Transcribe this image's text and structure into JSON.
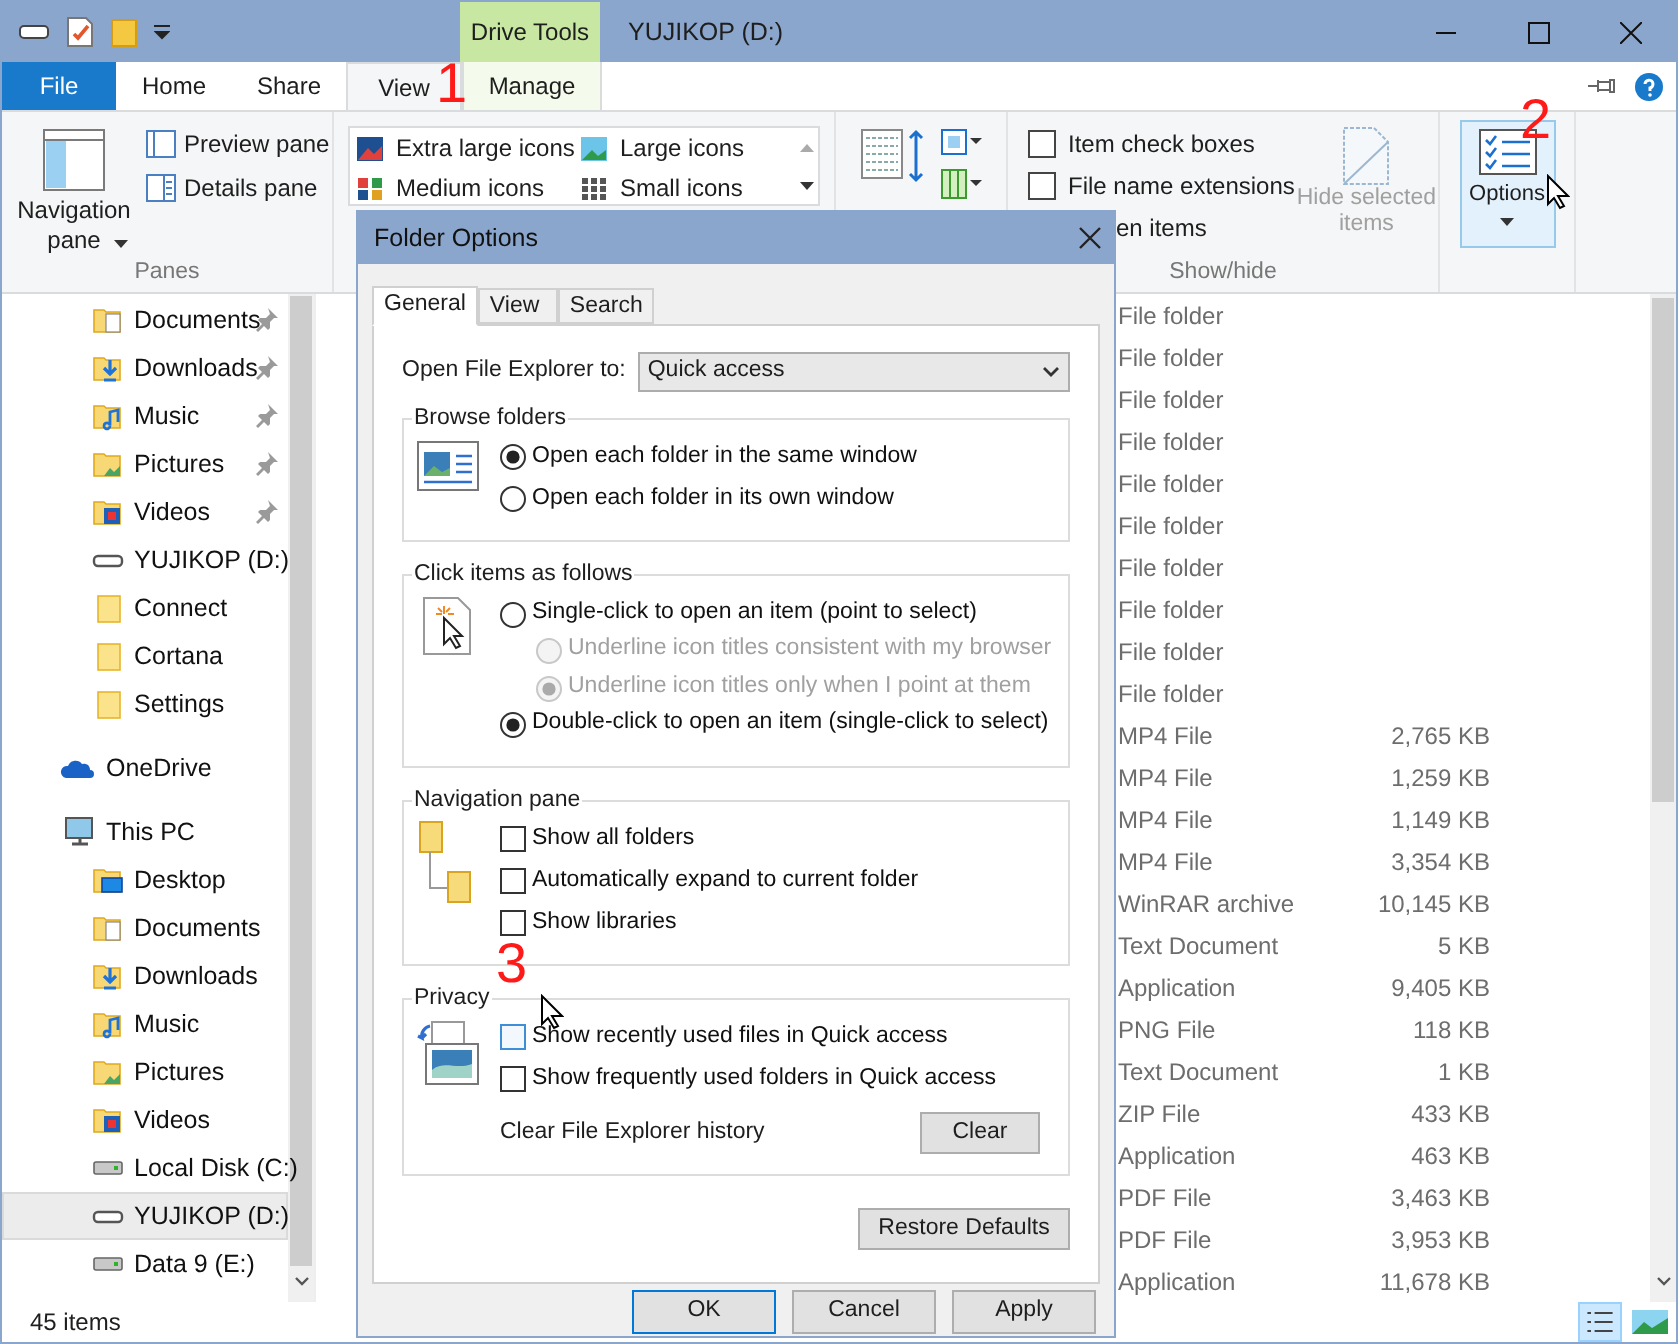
{
  "window": {
    "title": "YUJIKOP (D:)",
    "context_tab": "Drive Tools"
  },
  "ribbon_tabs": [
    {
      "label": "File",
      "kind": "file",
      "selected": false
    },
    {
      "label": "Home",
      "kind": "tab",
      "selected": false
    },
    {
      "label": "Share",
      "kind": "tab",
      "selected": false
    },
    {
      "label": "View",
      "kind": "tab",
      "selected": true
    },
    {
      "label": "Manage",
      "kind": "context",
      "selected": false
    }
  ],
  "ribbon": {
    "panes": {
      "navigation_pane": "Navigation pane",
      "preview_pane": "Preview pane",
      "details_pane": "Details pane",
      "label": "Panes"
    },
    "layout": [
      {
        "label": "Extra large icons",
        "kind": "xl"
      },
      {
        "label": "Large icons",
        "kind": "large"
      },
      {
        "label": "Medium icons",
        "kind": "medium"
      },
      {
        "label": "Small icons",
        "kind": "small"
      }
    ],
    "show_hide": {
      "checkboxes": [
        {
          "label": "Item check boxes",
          "checked": false
        },
        {
          "label": "File name extensions",
          "checked": false
        },
        {
          "label": "en items"
        }
      ],
      "hide_selected": "Hide selected items",
      "label": "Show/hide"
    },
    "options": "Options"
  },
  "navigation": {
    "quick_access_children": [
      {
        "label": "Documents",
        "kind": "documents",
        "pinned": true,
        "selected": false
      },
      {
        "label": "Downloads",
        "kind": "downloads",
        "pinned": true,
        "selected": false
      },
      {
        "label": "Music",
        "kind": "music",
        "pinned": true,
        "selected": false
      },
      {
        "label": "Pictures",
        "kind": "pictures",
        "pinned": true,
        "selected": false
      },
      {
        "label": "Videos",
        "kind": "videos",
        "pinned": true,
        "selected": false
      },
      {
        "label": "YUJIKOP (D:)",
        "kind": "usb",
        "pinned": false,
        "selected": false
      },
      {
        "label": "Connect",
        "kind": "folder",
        "pinned": false,
        "selected": false
      },
      {
        "label": "Cortana",
        "kind": "folder",
        "pinned": false,
        "selected": false
      },
      {
        "label": "Settings",
        "kind": "folder",
        "pinned": false,
        "selected": false
      }
    ],
    "roots": [
      {
        "label": "OneDrive",
        "kind": "onedrive",
        "selected": false
      },
      {
        "label": "This PC",
        "kind": "pc",
        "selected": false,
        "children": [
          {
            "label": "Desktop",
            "kind": "desktop",
            "selected": false
          },
          {
            "label": "Documents",
            "kind": "documents",
            "selected": false
          },
          {
            "label": "Downloads",
            "kind": "downloads",
            "selected": false
          },
          {
            "label": "Music",
            "kind": "music",
            "selected": false
          },
          {
            "label": "Pictures",
            "kind": "pictures",
            "selected": false
          },
          {
            "label": "Videos",
            "kind": "videos",
            "selected": false
          },
          {
            "label": "Local Disk (C:)",
            "kind": "disk",
            "selected": false
          },
          {
            "label": "YUJIKOP (D:)",
            "kind": "usb",
            "selected": true
          },
          {
            "label": "Data 9 (E:)",
            "kind": "disk",
            "selected": false
          }
        ]
      }
    ]
  },
  "files": [
    {
      "type": "File folder"
    },
    {
      "type": "File folder"
    },
    {
      "type": "File folder"
    },
    {
      "type": "File folder"
    },
    {
      "type": "File folder"
    },
    {
      "type": "File folder"
    },
    {
      "type": "File folder"
    },
    {
      "type": "File folder"
    },
    {
      "type": "File folder"
    },
    {
      "type": "File folder"
    },
    {
      "type": "MP4 File",
      "size": "2,765 KB"
    },
    {
      "type": "MP4 File",
      "size": "1,259 KB"
    },
    {
      "type": "MP4 File",
      "size": "1,149 KB"
    },
    {
      "type": "MP4 File",
      "size": "3,354 KB"
    },
    {
      "type": "WinRAR archive",
      "size": "10,145 KB"
    },
    {
      "type": "Text Document",
      "size": "5 KB"
    },
    {
      "type": "Application",
      "size": "9,405 KB"
    },
    {
      "type": "PNG File",
      "size": "118 KB"
    },
    {
      "type": "Text Document",
      "size": "1 KB"
    },
    {
      "type": "ZIP File",
      "size": "433 KB"
    },
    {
      "type": "Application",
      "size": "463 KB"
    },
    {
      "type": "PDF File",
      "size": "3,463 KB"
    },
    {
      "type": "PDF File",
      "size": "3,953 KB"
    },
    {
      "type": "Application",
      "size": "11,678 KB"
    }
  ],
  "status_bar": {
    "count": "45 items"
  },
  "dialog": {
    "title": "Folder Options",
    "tabs": [
      {
        "label": "General",
        "selected": true
      },
      {
        "label": "View",
        "selected": false
      },
      {
        "label": "Search",
        "selected": false
      }
    ],
    "open_to": {
      "label": "Open File Explorer to:",
      "value": "Quick access"
    },
    "groups": [
      {
        "title": "Browse folders",
        "kind": "window",
        "options": [
          {
            "kind": "radio",
            "label": "Open each folder in the same window",
            "selected": true,
            "disabled": false
          },
          {
            "kind": "radio",
            "label": "Open each folder in its own window",
            "selected": false,
            "disabled": false
          }
        ]
      },
      {
        "title": "Click items as follows",
        "kind": "click",
        "options": [
          {
            "kind": "radio",
            "label": "Single-click to open an item (point to select)",
            "selected": false,
            "disabled": false,
            "children": [
              {
                "kind": "radio",
                "label": "Underline icon titles consistent with my browser",
                "selected": false,
                "disabled": true
              },
              {
                "kind": "radio",
                "label": "Underline icon titles only when I point at them",
                "selected": true,
                "disabled": true
              }
            ]
          },
          {
            "kind": "radio",
            "label": "Double-click to open an item (single-click to select)",
            "selected": true,
            "disabled": false
          }
        ]
      },
      {
        "title": "Navigation pane",
        "kind": "folders",
        "options": [
          {
            "kind": "checkbox",
            "label": "Show all folders",
            "checked": false,
            "hovered": false
          },
          {
            "kind": "checkbox",
            "label": "Automatically expand to current folder",
            "checked": false,
            "hovered": false
          },
          {
            "kind": "checkbox",
            "label": "Show libraries",
            "checked": false,
            "hovered": false
          }
        ]
      },
      {
        "title": "Privacy",
        "kind": "privacy",
        "options": [
          {
            "kind": "checkbox",
            "label": "Show recently used files in Quick access",
            "checked": false,
            "hovered": true
          },
          {
            "kind": "checkbox",
            "label": "Show frequently used folders in Quick access",
            "checked": false,
            "hovered": false
          }
        ],
        "clear": {
          "label": "Clear File Explorer history",
          "button": "Clear"
        }
      }
    ],
    "restore_button": "Restore Defaults",
    "buttons": [
      {
        "label": "OK",
        "default": true
      },
      {
        "label": "Cancel",
        "default": false
      },
      {
        "label": "Apply",
        "default": false
      }
    ]
  },
  "annotations": [
    "1",
    "2",
    "3"
  ]
}
